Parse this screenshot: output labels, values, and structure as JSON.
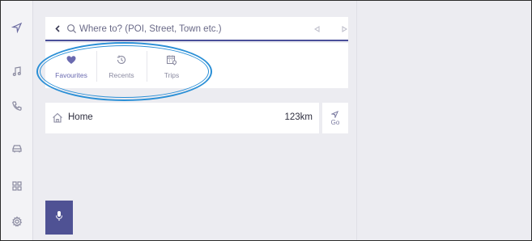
{
  "search": {
    "placeholder": "Where to? (POI, Street, Town etc.)"
  },
  "rail": {
    "items": [
      {
        "name": "navigation",
        "icon": "navigation-arrow-icon"
      },
      {
        "name": "music",
        "icon": "music-note-icon"
      },
      {
        "name": "phone",
        "icon": "phone-icon"
      },
      {
        "name": "vehicle",
        "icon": "car-icon"
      },
      {
        "name": "apps",
        "icon": "grid-icon"
      },
      {
        "name": "settings",
        "icon": "gear-icon"
      }
    ]
  },
  "quick_tabs": [
    {
      "label": "Favourites",
      "icon": "heart-icon",
      "selected": true
    },
    {
      "label": "Recents",
      "icon": "history-icon",
      "selected": false
    },
    {
      "label": "Trips",
      "icon": "calendar-pin-icon",
      "selected": false
    }
  ],
  "home": {
    "label": "Home",
    "distance": "123km",
    "go_label": "Go"
  },
  "colors": {
    "accent": "#4f5294",
    "highlight": "#2a8fd6",
    "background": "#ececf1"
  }
}
